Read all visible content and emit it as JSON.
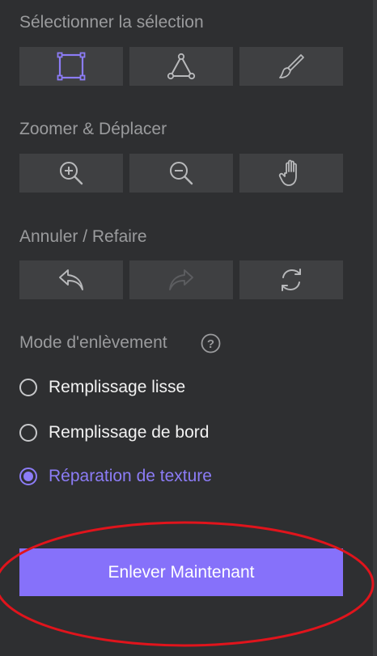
{
  "sections": {
    "selection": {
      "title": "Sélectionner la sélection",
      "buttons": [
        {
          "icon": "rectangle-select-icon",
          "active": true
        },
        {
          "icon": "polygon-lasso-icon",
          "active": false
        },
        {
          "icon": "brush-icon",
          "active": false
        }
      ]
    },
    "zoom": {
      "title": "Zoomer & Déplacer",
      "buttons": [
        {
          "icon": "zoom-in-icon"
        },
        {
          "icon": "zoom-out-icon"
        },
        {
          "icon": "hand-pan-icon"
        }
      ]
    },
    "undo": {
      "title": "Annuler / Refaire",
      "buttons": [
        {
          "icon": "undo-icon",
          "enabled": true
        },
        {
          "icon": "redo-icon",
          "enabled": false
        },
        {
          "icon": "reset-icon",
          "enabled": true
        }
      ]
    },
    "mode": {
      "title": "Mode d'enlèvement",
      "help_icon": "help-icon",
      "options": [
        {
          "label": "Remplissage lisse",
          "selected": false
        },
        {
          "label": "Remplissage de bord",
          "selected": false
        },
        {
          "label": "Réparation de texture",
          "selected": true
        }
      ]
    }
  },
  "action": {
    "remove_label": "Enlever Maintenant"
  },
  "colors": {
    "background": "#2e2f31",
    "button_bg": "#3f4042",
    "accent": "#8671fa",
    "annotation": "#e0141c"
  }
}
